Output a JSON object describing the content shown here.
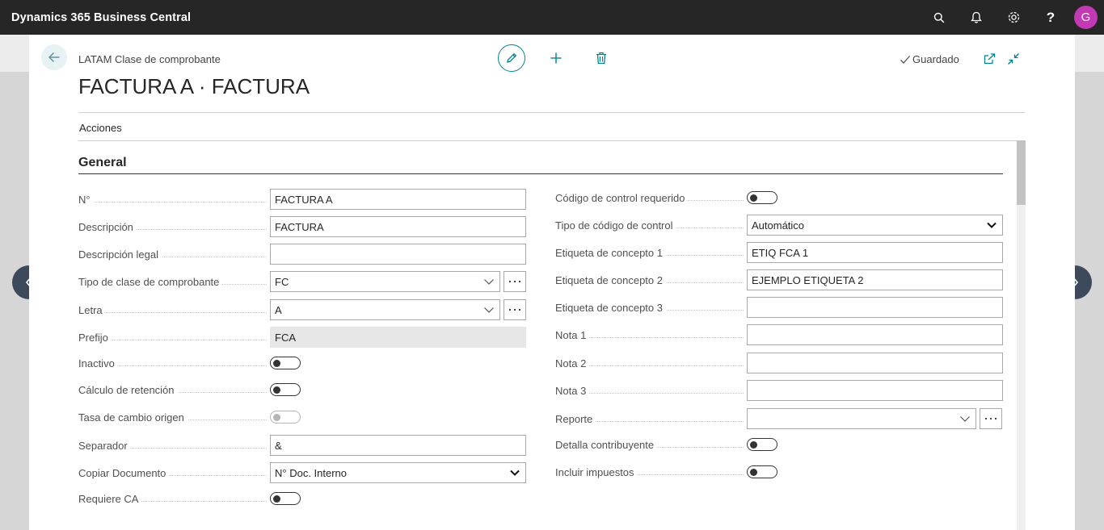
{
  "app": {
    "title": "Dynamics 365 Business Central",
    "avatar_initial": "G"
  },
  "header": {
    "breadcrumb": "LATAM Clase de comprobante",
    "title": "FACTURA A · FACTURA",
    "saved_label": "Guardado",
    "actions_label": "Acciones"
  },
  "section": {
    "title": "General"
  },
  "left_fields": [
    {
      "label": "N°",
      "value": "FACTURA A"
    },
    {
      "label": "Descripción",
      "value": "FACTURA"
    },
    {
      "label": "Descripción legal",
      "value": ""
    },
    {
      "label": "Tipo de clase de comprobante",
      "value": "FC"
    },
    {
      "label": "Letra",
      "value": "A"
    },
    {
      "label": "Prefijo",
      "value": "FCA"
    },
    {
      "label": "Inactivo",
      "value": false
    },
    {
      "label": "Cálculo de retención",
      "value": false
    },
    {
      "label": "Tasa de cambio origen",
      "value": false
    },
    {
      "label": "Separador",
      "value": "&"
    },
    {
      "label": "Copiar Documento",
      "value": "N° Doc. Interno"
    },
    {
      "label": "Requiere CA",
      "value": false
    }
  ],
  "right_fields": [
    {
      "label": "Código de control requerido",
      "value": false
    },
    {
      "label": "Tipo de código de control",
      "value": "Automático"
    },
    {
      "label": "Etiqueta de concepto 1",
      "value": "ETIQ FCA 1"
    },
    {
      "label": "Etiqueta de concepto 2",
      "value": "EJEMPLO ETIQUETA 2"
    },
    {
      "label": "Etiqueta de concepto 3",
      "value": ""
    },
    {
      "label": "Nota 1",
      "value": ""
    },
    {
      "label": "Nota 2",
      "value": ""
    },
    {
      "label": "Nota 3",
      "value": ""
    },
    {
      "label": "Reporte",
      "value": ""
    },
    {
      "label": "Detalla contribuyente",
      "value": false
    },
    {
      "label": "Incluir impuestos",
      "value": false
    }
  ],
  "colors": {
    "appbar": "#262626",
    "accent": "#00838f",
    "avatar": "#c239b3",
    "nav_arrow": "#3d4a5c"
  },
  "icons": [
    "search-icon",
    "bell-icon",
    "gear-icon",
    "help-icon",
    "back-arrow-icon",
    "pencil-icon",
    "plus-icon",
    "trash-icon",
    "checkmark-icon",
    "popout-icon",
    "collapse-icon",
    "chevron-left-icon",
    "chevron-right-icon"
  ]
}
